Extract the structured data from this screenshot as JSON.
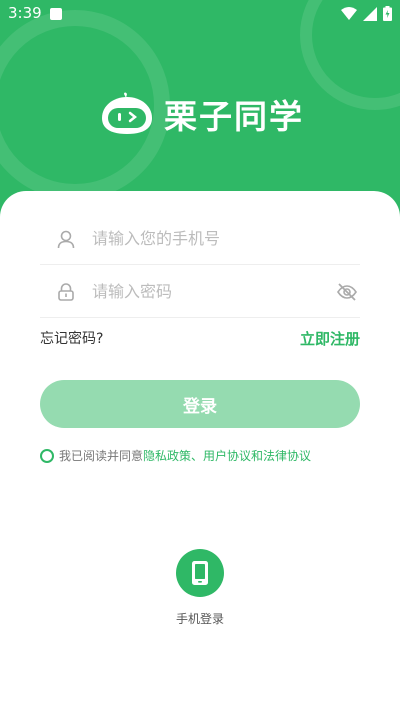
{
  "status_bar": {
    "time": "3:39",
    "icons": [
      "app-notification-icon",
      "wifi-icon",
      "signal-icon",
      "battery-icon"
    ]
  },
  "brand": {
    "name": "栗子同学",
    "logo_icon": "chestnut-logo-icon"
  },
  "login_form": {
    "phone_placeholder": "请输入您的手机号",
    "phone_value": "",
    "password_placeholder": "请输入密码",
    "password_value": "",
    "forgot_password": "忘记密码?",
    "register": "立即注册",
    "submit": "登录"
  },
  "agreement": {
    "prefix": "我已阅读并同意",
    "policy_link": "隐私政策、用户协议和法律协议",
    "checked": false
  },
  "alt_login": {
    "phone_login_label": "手机登录"
  },
  "colors": {
    "brand_green": "#2fb866",
    "disabled_button": "#95dbb0",
    "placeholder_gray": "#bcbcbc"
  }
}
